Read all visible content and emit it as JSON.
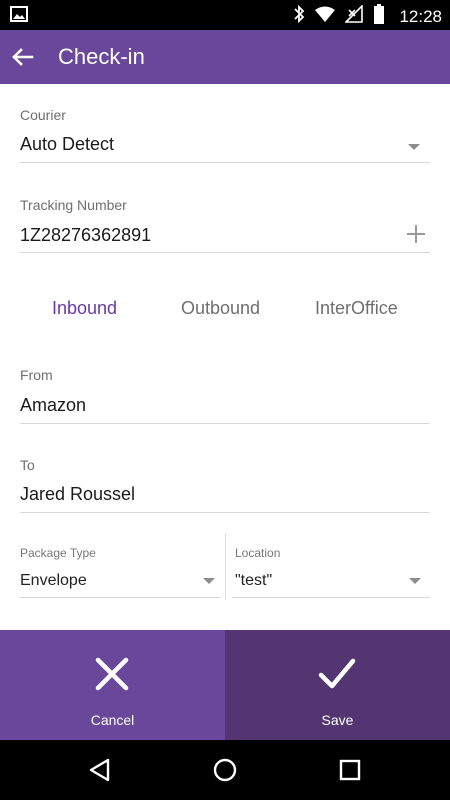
{
  "status_bar": {
    "time": "12:28",
    "icons": [
      "image-icon",
      "bluetooth-icon",
      "wifi-icon",
      "no-signal-icon",
      "battery-icon"
    ]
  },
  "app_bar": {
    "title": "Check-in",
    "back_icon": "back-arrow-icon",
    "background": "#69479b"
  },
  "form": {
    "courier": {
      "label": "Courier",
      "value": "Auto Detect"
    },
    "tracking": {
      "label": "Tracking Number",
      "value": "1Z28276362891",
      "add_icon": "plus-icon"
    },
    "direction_tabs": [
      {
        "label": "Inbound",
        "selected": true
      },
      {
        "label": "Outbound",
        "selected": false
      },
      {
        "label": "InterOffice",
        "selected": false
      }
    ],
    "from": {
      "label": "From",
      "value": "Amazon"
    },
    "to": {
      "label": "To",
      "value": "Jared Roussel"
    },
    "package_type": {
      "label": "Package Type",
      "value": "Envelope"
    },
    "location": {
      "label": "Location",
      "value": "\"test\""
    }
  },
  "actions": {
    "cancel": {
      "label": "Cancel",
      "icon": "close-icon"
    },
    "save": {
      "label": "Save",
      "icon": "check-icon"
    }
  },
  "nav_bar": {
    "buttons": [
      "back-triangle-icon",
      "home-circle-icon",
      "recents-square-icon"
    ]
  },
  "colors": {
    "primary": "#69479b",
    "primary_dark": "#533671",
    "active_tab": "#6b3aa0"
  }
}
